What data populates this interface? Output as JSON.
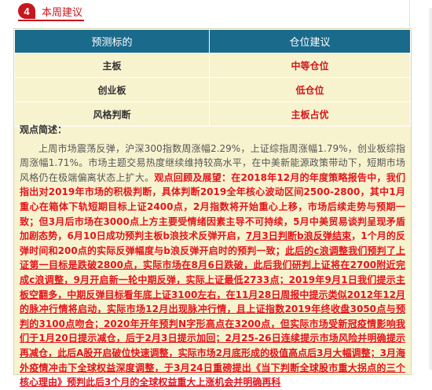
{
  "section": {
    "number": "4",
    "title": "本周建议"
  },
  "table": {
    "headers": [
      "预测标的",
      "仓位建议"
    ],
    "rows": [
      {
        "target": "主板",
        "position": "中等仓位"
      },
      {
        "target": "创业板",
        "position": "低仓位"
      },
      {
        "target": "风格判断",
        "position": "主板占优"
      }
    ]
  },
  "summary": {
    "label": "观点简述：",
    "segments": [
      {
        "text": "上周市场震荡反弹，沪深300指数周涨幅2.29%，上证综指周涨幅1.79%，创业板综指周涨幅1.71%。市场主题交易热度继续维持较高水平，在中美新能源政策带动下，短期市场风格仍在极端偏离状态上扩大。",
        "style": "normal"
      },
      {
        "text": "观点回顾及展望：在2018年12月的年度策略报告中，我们指出对2019年市场的积极判断，具体判断2019全年核心波动区间2500-2800，其中1月重心在箱体下轨短期目标上证2400点，2月指数将开始重心上移，市场后续走势与预期一致；但3月后市场在3000点上方主要受情绪因素主导不可持续，5月中美贸易谈判呈现矛盾加剧态势，6月10日成功预判主板b浪技术反弹开启，",
        "style": "red"
      },
      {
        "text": "7月3日判断b浪反弹结束",
        "style": "red-underline"
      },
      {
        "text": "，1个月的反弹时间和200点的实际反弹幅度与b浪反弹开启时的预判一致；",
        "style": "red"
      },
      {
        "text": "此后的c浪调整我们预判了上证第一目标是跌破2800点，实际市场在8月6日跌破，此后我们研判上证将在2700附近完成c浪调整，9月开启新一轮中期反弹，实际上证最低2733点；2019年9月1日我们提示主板空翻多，中期反弹目标看年底上证3100左右，在11月28日周报中提示类似2012年12月的脉冲行情将启动，实际市场12月出现脉冲行情，且上证指数2019年终收盘3050点与预判的3100点吻合；2020年开年预判N字形高点在3200点，但实际市场受新冠疫情影响我们于1月20日提示减仓，后于2月3日提示加回；2月25-26日连续提示市场风险并明确提示再减仓，此后A股开启破位快速调整，实际市场2月底形成的极值高点后3月大幅调整；3月海外疫情冲击下全球权益深度调整，于3月24日重磅提出《当下判断全球股市重大拐点的三个核心理由》预判此后3个月的全球权益重大上涨机会并明确再科",
        "style": "red-underline"
      }
    ]
  }
}
